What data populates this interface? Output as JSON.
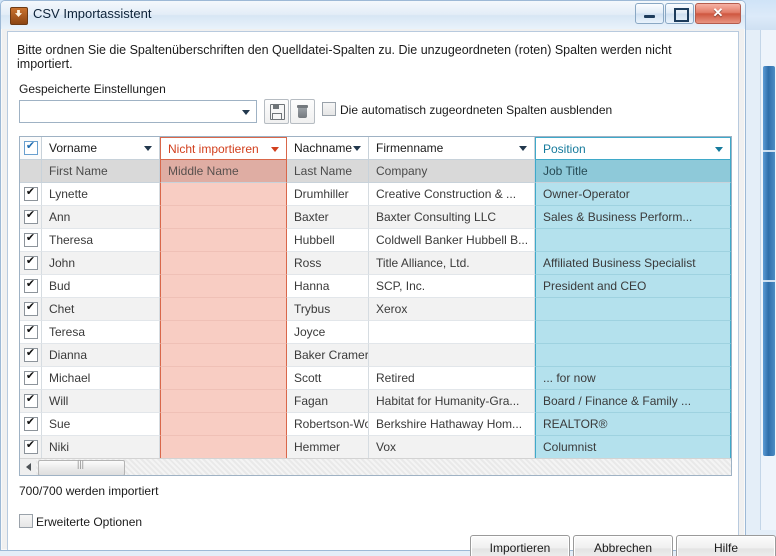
{
  "window": {
    "title": "CSV Importassistent",
    "icon": "import-icon",
    "minimize_label": "",
    "maximize_label": "",
    "close_label": "✕"
  },
  "instruction": "Bitte ordnen Sie die Spaltenüberschriften den Quelldatei-Spalten zu. Die unzugeordneten (roten) Spalten werden nicht importiert.",
  "settings": {
    "group_label": "Gespeicherte Einstellungen",
    "combo_value": "",
    "combo_placeholder": "",
    "save_icon": "save-icon",
    "delete_icon": "trash-icon",
    "hide_auto_label": "Die automatisch zugeordneten Spalten ausblenden",
    "hide_auto_checked": false
  },
  "table": {
    "select_all_checked": true,
    "columns": [
      {
        "header": "Vorname",
        "source": "First Name",
        "state": "normal"
      },
      {
        "header": "Nicht importieren",
        "source": "Middle Name",
        "state": "excluded"
      },
      {
        "header": "Nachname",
        "source": "Last Name",
        "state": "normal"
      },
      {
        "header": "Firmenname",
        "source": "Company",
        "state": "normal"
      },
      {
        "header": "Position",
        "source": "Job Title",
        "state": "selected"
      }
    ],
    "rows": [
      {
        "checked": true,
        "cells": [
          "Lynette",
          "",
          "Drumhiller",
          "Creative Construction & ...",
          "Owner-Operator"
        ]
      },
      {
        "checked": true,
        "cells": [
          "Ann",
          "",
          "Baxter",
          "Baxter Consulting LLC",
          "Sales & Business Perform..."
        ]
      },
      {
        "checked": true,
        "cells": [
          "Theresa",
          "",
          "Hubbell",
          "Coldwell Banker Hubbell B...",
          ""
        ]
      },
      {
        "checked": true,
        "cells": [
          "John",
          "",
          "Ross",
          "Title Alliance, Ltd.",
          "Affiliated Business Specialist"
        ]
      },
      {
        "checked": true,
        "cells": [
          "Bud",
          "",
          "Hanna",
          "SCP, Inc.",
          "President and CEO"
        ]
      },
      {
        "checked": true,
        "cells": [
          "Chet",
          "",
          "Trybus",
          "Xerox",
          ""
        ]
      },
      {
        "checked": true,
        "cells": [
          "Teresa",
          "",
          "Joyce",
          "",
          ""
        ]
      },
      {
        "checked": true,
        "cells": [
          "Dianna",
          "",
          "Baker Cramer",
          "",
          ""
        ]
      },
      {
        "checked": true,
        "cells": [
          "Michael",
          "",
          "Scott",
          "Retired",
          "... for now"
        ]
      },
      {
        "checked": true,
        "cells": [
          "Will",
          "",
          "Fagan",
          "Habitat for Humanity-Gra...",
          "Board / Finance & Family ..."
        ]
      },
      {
        "checked": true,
        "cells": [
          "Sue",
          "",
          "Robertson-Wolinski",
          "Berkshire Hathaway Hom...",
          "REALTOR®"
        ]
      },
      {
        "checked": true,
        "cells": [
          "Niki",
          "",
          "Hemmer",
          "Vox",
          "Columnist"
        ]
      }
    ]
  },
  "footer": {
    "count_text": "700/700 werden importiert",
    "advanced_label": "Erweiterte Optionen",
    "advanced_checked": false,
    "import_label": "Importieren",
    "cancel_label": "Abbrechen",
    "help_label": "Hilfe"
  },
  "colors": {
    "excluded": "#d2401e",
    "excluded_fill": "#f8cdc3",
    "selected": "#157a9c",
    "selected_fill": "#b4e1ed",
    "close_button": "#cf5740"
  }
}
